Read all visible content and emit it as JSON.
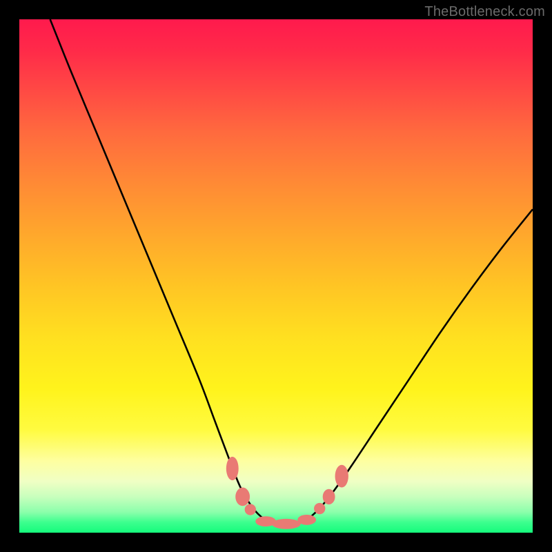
{
  "watermark": "TheBottleneck.com",
  "colors": {
    "frame": "#000000",
    "curve_stroke": "#000000",
    "marker_fill": "#e97a74",
    "marker_stroke": "#c55a54"
  },
  "chart_data": {
    "type": "line",
    "title": "",
    "xlabel": "",
    "ylabel": "",
    "xlim": [
      0,
      100
    ],
    "ylim": [
      0,
      100
    ],
    "grid": false,
    "legend": false,
    "annotations": [],
    "series": [
      {
        "name": "curve",
        "x": [
          6,
          10,
          15,
          20,
          25,
          30,
          35,
          38,
          41,
          43,
          45,
          47,
          49,
          51,
          53,
          55,
          57,
          60,
          64,
          70,
          76,
          82,
          88,
          94,
          100
        ],
        "y": [
          100,
          90,
          78,
          66,
          54,
          42,
          30,
          22,
          14,
          9,
          5.5,
          3.2,
          2.1,
          1.7,
          1.7,
          2.1,
          3.3,
          6.5,
          12,
          21,
          30,
          39,
          47.5,
          55.5,
          63
        ]
      }
    ],
    "markers": [
      {
        "x": 41.5,
        "y": 12.5,
        "rx": 1.2,
        "ry": 2.3
      },
      {
        "x": 43.5,
        "y": 7.0,
        "rx": 1.4,
        "ry": 1.8
      },
      {
        "x": 45.0,
        "y": 4.5,
        "rx": 1.1,
        "ry": 1.1
      },
      {
        "x": 48.0,
        "y": 2.2,
        "rx": 2.0,
        "ry": 1.0
      },
      {
        "x": 52.0,
        "y": 1.7,
        "rx": 2.8,
        "ry": 1.0
      },
      {
        "x": 56.0,
        "y": 2.5,
        "rx": 1.8,
        "ry": 1.0
      },
      {
        "x": 58.5,
        "y": 4.7,
        "rx": 1.1,
        "ry": 1.1
      },
      {
        "x": 60.3,
        "y": 7.0,
        "rx": 1.2,
        "ry": 1.5
      },
      {
        "x": 62.8,
        "y": 11.0,
        "rx": 1.3,
        "ry": 2.2
      }
    ]
  }
}
